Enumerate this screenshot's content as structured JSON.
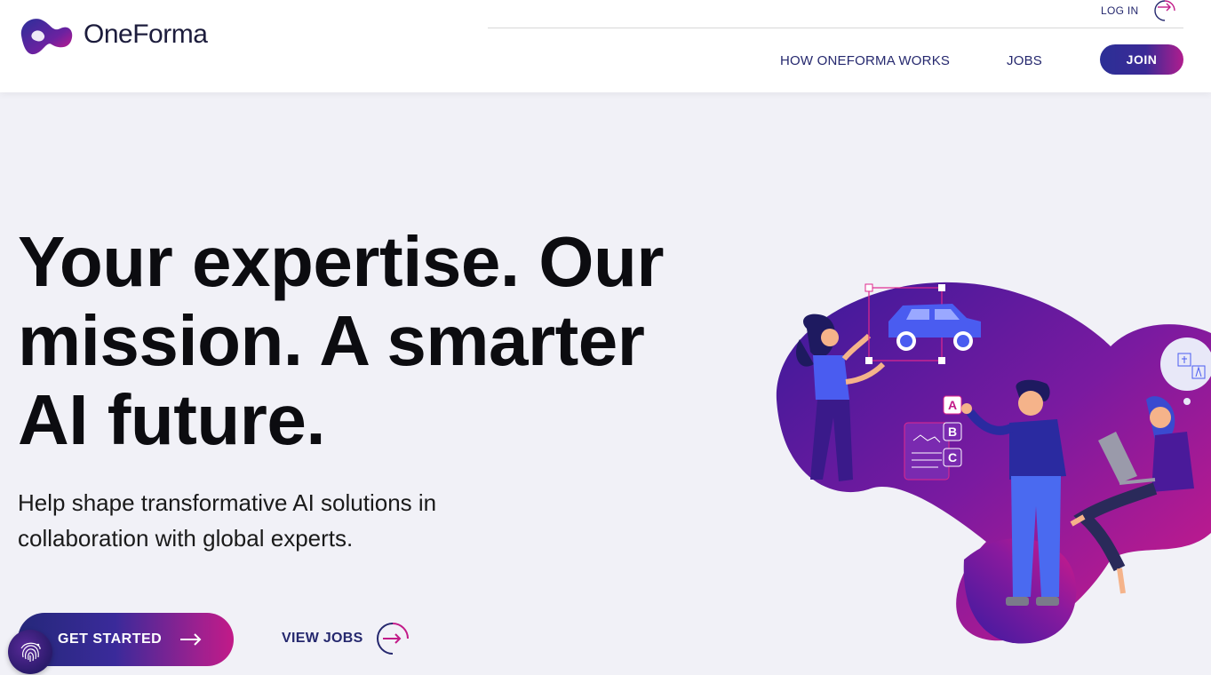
{
  "brand": {
    "name": "OneForma"
  },
  "header": {
    "login_label": "LOG IN",
    "nav": [
      {
        "label": "HOW ONEFORMA WORKS"
      },
      {
        "label": "JOBS"
      }
    ],
    "join_label": "JOIN"
  },
  "hero": {
    "title": "Your expertise. Our mission. A smarter AI future.",
    "subtitle": "Help shape transformative AI solutions in collaboration with global experts.",
    "primary_cta": "GET STARTED",
    "secondary_cta": "VIEW JOBS"
  },
  "illustration": {
    "options": [
      "A",
      "B",
      "C"
    ]
  },
  "colors": {
    "brand_navy": "#25286e",
    "brand_purple": "#5a2a9a",
    "brand_magenta": "#c21a88",
    "background": "#f1f1f7"
  },
  "icons": [
    "oneforma-logo-icon",
    "arrow-right-circle-icon",
    "arrow-right-icon",
    "fingerprint-icon",
    "car-icon",
    "translate-icon"
  ]
}
